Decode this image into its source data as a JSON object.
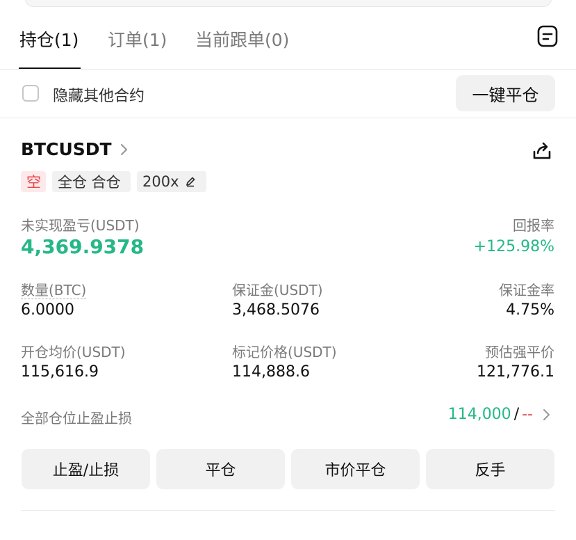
{
  "tabs": [
    {
      "label": "持仓(1)",
      "active": true
    },
    {
      "label": "订单(1)",
      "active": false
    },
    {
      "label": "当前跟单(0)",
      "active": false
    }
  ],
  "filter": {
    "hide_other_label": "隐藏其他合约",
    "checked": false
  },
  "close_all_label": "一键平仓",
  "position": {
    "symbol": "BTCUSDT",
    "tags": {
      "side": "空",
      "mode": "全仓 合仓",
      "leverage": "200x"
    },
    "pnl_label": "未实现盈亏(USDT)",
    "pnl_value": "4,369.9378",
    "roe_label": "回报率",
    "roe_value": "+125.98%",
    "qty_label": "数量(BTC)",
    "qty_value": "6.0000",
    "margin_label": "保证金(USDT)",
    "margin_value": "3,468.5076",
    "margin_ratio_label": "保证金率",
    "margin_ratio_value": "4.75%",
    "entry_label": "开仓均价(USDT)",
    "entry_value": "115,616.9",
    "mark_label": "标记价格(USDT)",
    "mark_value": "114,888.6",
    "liq_label": "预估强平价",
    "liq_value": "121,776.1",
    "tpsl_label": "全部仓位止盈止损",
    "tp_value": "114,000",
    "separator": "/",
    "sl_value": "--"
  },
  "actions": {
    "tpsl": "止盈/止损",
    "close": "平仓",
    "market_close": "市价平仓",
    "reverse": "反手"
  },
  "colors": {
    "profit": "#25b887",
    "loss": "#e5484d"
  }
}
